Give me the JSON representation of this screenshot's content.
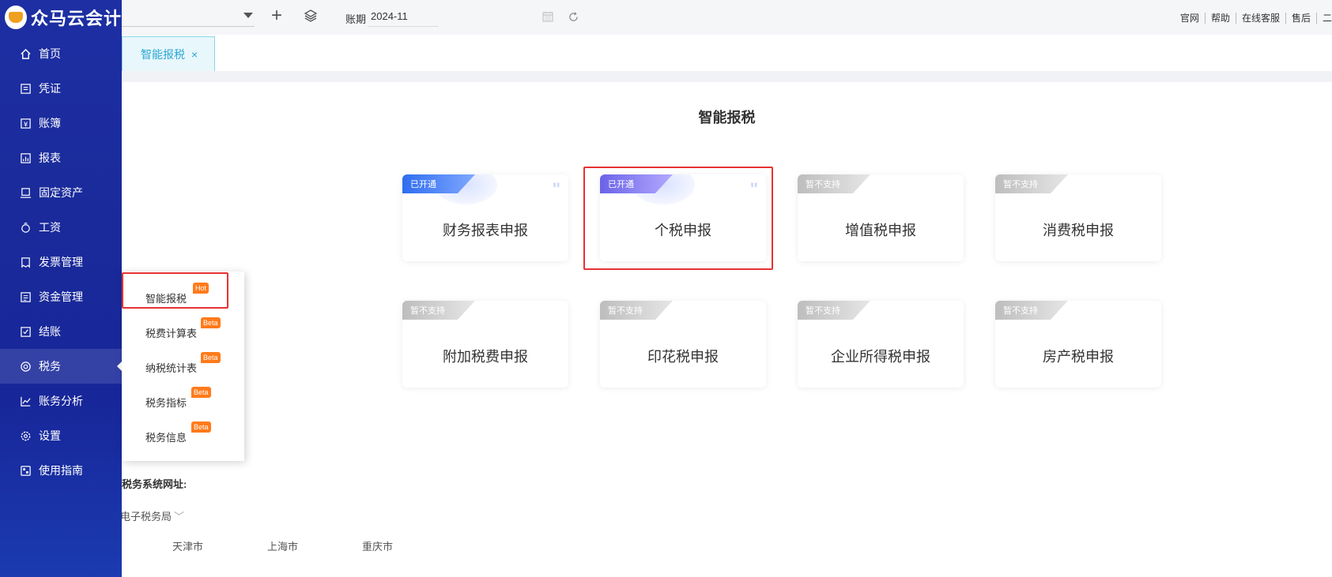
{
  "app": {
    "name": "众马云会计"
  },
  "sidebar": {
    "items": [
      {
        "label": "首页",
        "icon": "home-icon"
      },
      {
        "label": "凭证",
        "icon": "voucher-icon"
      },
      {
        "label": "账簿",
        "icon": "ledger-icon"
      },
      {
        "label": "报表",
        "icon": "report-icon"
      },
      {
        "label": "固定资产",
        "icon": "asset-icon"
      },
      {
        "label": "工资",
        "icon": "salary-icon"
      },
      {
        "label": "发票管理",
        "icon": "invoice-icon"
      },
      {
        "label": "资金管理",
        "icon": "fund-icon"
      },
      {
        "label": "结账",
        "icon": "closing-icon"
      },
      {
        "label": "税务",
        "icon": "tax-icon",
        "active": true
      },
      {
        "label": "账务分析",
        "icon": "analysis-icon"
      },
      {
        "label": "设置",
        "icon": "settings-icon"
      },
      {
        "label": "使用指南",
        "icon": "guide-icon"
      }
    ]
  },
  "topbar": {
    "book_value": "",
    "period_label": "账期",
    "period_value": "2024-11",
    "links": [
      "官网",
      "帮助",
      "在线客服",
      "售后",
      "二"
    ]
  },
  "tabs": [
    {
      "label": "智能报税",
      "close": "×"
    }
  ],
  "main": {
    "title": "智能报税",
    "cards": [
      {
        "label": "财务报表申报",
        "status": "已开通",
        "state": "on"
      },
      {
        "label": "个税申报",
        "status": "已开通",
        "state": "purple"
      },
      {
        "label": "增值税申报",
        "status": "暂不支持",
        "state": "off"
      },
      {
        "label": "消费税申报",
        "status": "暂不支持",
        "state": "off"
      },
      {
        "label": "附加税费申报",
        "status": "暂不支持",
        "state": "off"
      },
      {
        "label": "印花税申报",
        "status": "暂不支持",
        "state": "off"
      },
      {
        "label": "企业所得税申报",
        "status": "暂不支持",
        "state": "off"
      },
      {
        "label": "房产税申报",
        "status": "暂不支持",
        "state": "off"
      }
    ],
    "tax_site_label": "税务系统网址:",
    "bureau_label": "电子税务局",
    "cities": [
      "天津市",
      "上海市",
      "重庆市"
    ]
  },
  "submenu": {
    "items": [
      {
        "label": "智能报税",
        "badge": "Hot"
      },
      {
        "label": "税费计算表",
        "badge": "Beta"
      },
      {
        "label": "纳税统计表",
        "badge": "Beta"
      },
      {
        "label": "税务指标",
        "badge": "Beta"
      },
      {
        "label": "税务信息",
        "badge": "Beta"
      }
    ]
  },
  "colors": {
    "sidebar": "#1d2fa3",
    "accent_tab": "#2aa7d4",
    "highlight": "#e53333",
    "badge": "#ff7a1a"
  }
}
